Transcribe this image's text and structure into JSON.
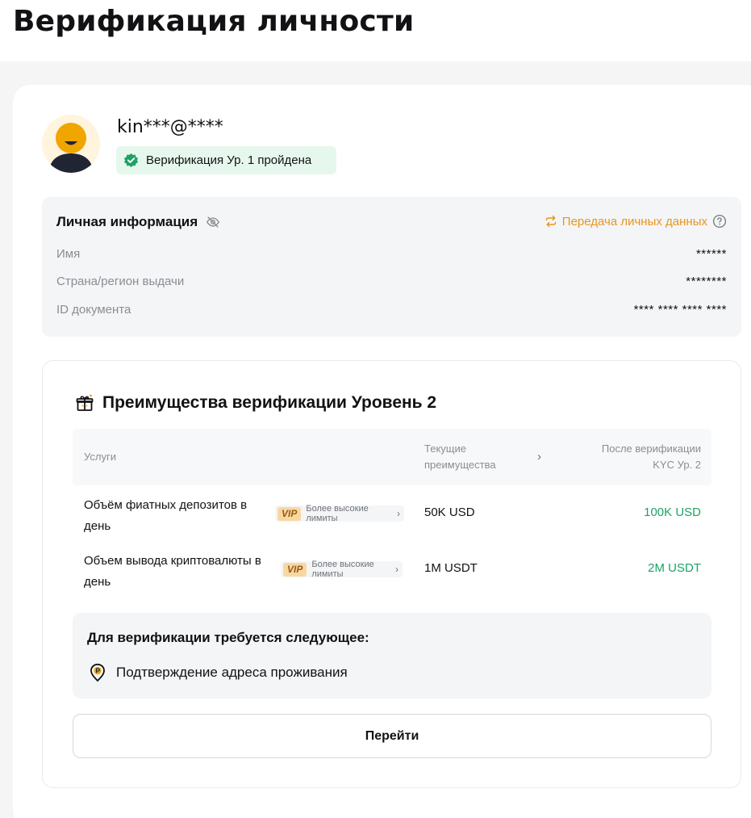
{
  "page": {
    "title": "Верификация личности"
  },
  "user": {
    "name": "kin***@****",
    "badge": "Верификация Ур. 1 пройдена",
    "badge_color": "#1ea266"
  },
  "personal_info": {
    "title": "Личная информация",
    "transfer_link": "Передача личных данных",
    "rows": [
      {
        "label": "Имя",
        "value": "******"
      },
      {
        "label": "Страна/регион выдачи",
        "value": "********"
      },
      {
        "label": "ID документа",
        "value": "**** **** **** ****"
      }
    ]
  },
  "benefits": {
    "title": "Преимущества верификации Уровень 2",
    "table_headers": {
      "service": "Услуги",
      "current": "Текущие преимущества",
      "after": "После верификации KYC Ур. 2"
    },
    "rows": [
      {
        "service": "Объём фиатных депозитов в день",
        "vip_tag": "VIP",
        "vip_text": "Более высокие лимиты",
        "current": "50K USD",
        "after": "100K USD"
      },
      {
        "service": "Объем вывода криптовалюты в день",
        "vip_tag": "VIP",
        "vip_text": "Более высокие лимиты",
        "current": "1M USDT",
        "after": "2M USDT"
      }
    ],
    "requirements_title": "Для верификации требуется следующее:",
    "requirements": [
      "Подтверждение адреса проживания"
    ],
    "go_button": "Перейти"
  },
  "colors": {
    "accent_orange": "#e6961e",
    "positive_green": "#1ea266",
    "vip_bg": "#f8d8a2"
  }
}
